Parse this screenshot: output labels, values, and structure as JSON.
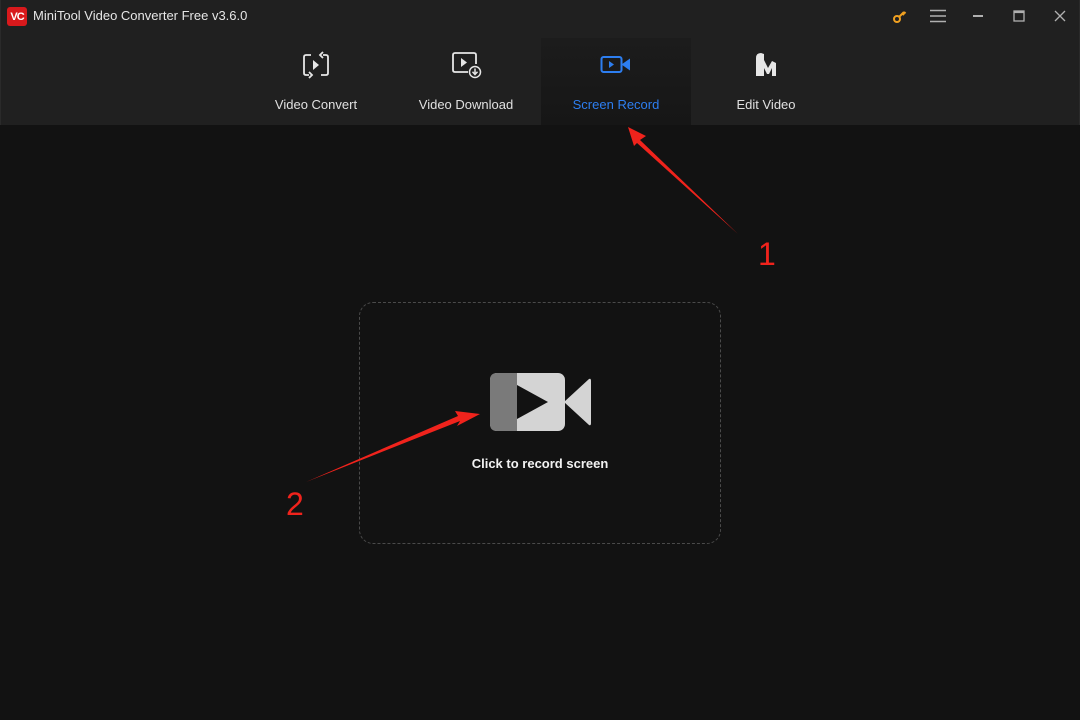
{
  "titlebar": {
    "logo_text": "VC",
    "title": "MiniTool Video Converter Free v3.6.0",
    "controls": [
      {
        "name": "key-icon",
        "label": "activate"
      },
      {
        "name": "menu-icon",
        "label": "menu"
      },
      {
        "name": "minimize-icon",
        "label": "minimize"
      },
      {
        "name": "maximize-icon",
        "label": "maximize"
      },
      {
        "name": "close-icon",
        "label": "close"
      }
    ],
    "key_color": "#f0a020"
  },
  "tabs": [
    {
      "label": "Video Convert",
      "icon": "convert-icon",
      "active": false
    },
    {
      "label": "Video Download",
      "icon": "download-icon",
      "active": false
    },
    {
      "label": "Screen Record",
      "icon": "camera-icon",
      "active": true
    },
    {
      "label": "Edit Video",
      "icon": "edit-video-icon",
      "active": false
    }
  ],
  "accent_color": "#2d7ef0",
  "main": {
    "record_label": "Click to record screen"
  },
  "annotations": [
    {
      "number": "1",
      "target": "Screen Record tab"
    },
    {
      "number": "2",
      "target": "record camera icon"
    }
  ]
}
